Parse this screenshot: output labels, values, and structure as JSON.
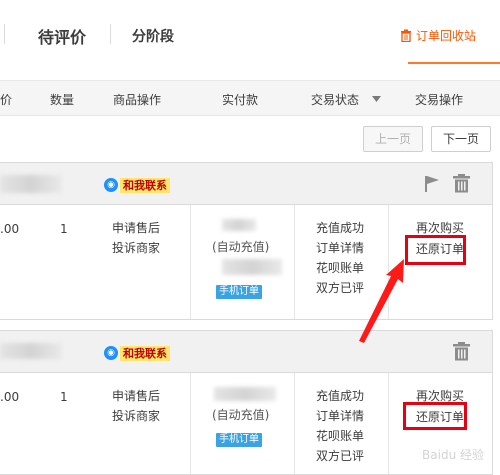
{
  "tabs": {
    "pending_review": "待评价",
    "installment": "分阶段",
    "recycle_bin": "订单回收站"
  },
  "table_header": {
    "price": "价",
    "quantity": "数量",
    "product_actions": "商品操作",
    "amount_paid": "实付款",
    "trade_status": "交易状态",
    "trade_actions": "交易操作"
  },
  "pager": {
    "prev": "上一页",
    "next": "下一页"
  },
  "orders": [
    {
      "contact": "和我联系",
      "price": ".00",
      "quantity": "1",
      "product_actions": [
        "申请售后",
        "投诉商家"
      ],
      "auto_recharge": "(自动充值)",
      "phone_order_tag": "手机订单",
      "status_items": [
        "充值成功",
        "订单详情",
        "花呗账单",
        "双方已评"
      ],
      "trade_actions": [
        "再次购买",
        "还原订单"
      ]
    },
    {
      "contact": "和我联系",
      "price": ".00",
      "quantity": "1",
      "product_actions": [
        "申请售后",
        "投诉商家"
      ],
      "auto_recharge": "(自动充值)",
      "phone_order_tag": "手机订单",
      "status_items": [
        "充值成功",
        "订单详情",
        "花呗账单",
        "双方已评"
      ],
      "trade_actions": [
        "再次购买",
        "还原订单"
      ]
    }
  ],
  "colors": {
    "accent": "#ff5500",
    "highlight": "#e60012",
    "arrow": "#ff1a1a"
  },
  "watermark": "Baidu 经验"
}
